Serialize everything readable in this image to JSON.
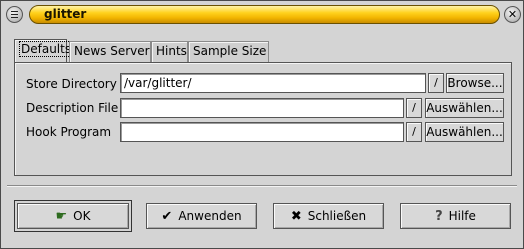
{
  "window": {
    "title": "glitter"
  },
  "tabs": [
    {
      "label": "Defaults",
      "active": true
    },
    {
      "label": "News Server",
      "active": false
    },
    {
      "label": "Hints",
      "active": false
    },
    {
      "label": "Sample Size",
      "active": false
    }
  ],
  "fields": [
    {
      "label": "Store Directory",
      "value": "/var/glitter/",
      "button": "Browse..."
    },
    {
      "label": "Description File",
      "value": "",
      "button": "Auswählen..."
    },
    {
      "label": "Hook Program",
      "value": "",
      "button": "Auswählen..."
    }
  ],
  "arrow_glyph": "/",
  "buttons": {
    "ok": "OK",
    "apply": "Anwenden",
    "close": "Schließen",
    "help": "Hilfe"
  },
  "icons": {
    "ok": "ok-hand-icon",
    "apply": "checkmark-icon",
    "close": "x-icon",
    "help": "question-icon"
  },
  "colors": {
    "title_bar": "#ffd21d",
    "window_bg": "#d4d4d4"
  }
}
